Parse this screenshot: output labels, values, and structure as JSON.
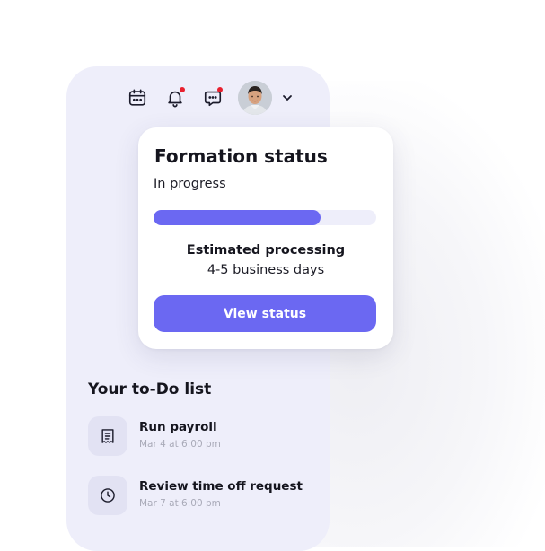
{
  "header": {
    "icons": [
      "calendar-icon",
      "bell-icon",
      "chat-icon"
    ],
    "notification_color": "#e8202e",
    "avatar": "user-avatar",
    "menu_chevron": "chevron-down-icon"
  },
  "formation_card": {
    "title": "Formation status",
    "status": "In progress",
    "progress_fraction": 0.75,
    "estimated_label": "Estimated processing",
    "estimated_value": "4-5 business days",
    "button_label": "View status",
    "accent_color": "#6b68f2"
  },
  "todo": {
    "title": "Your to-Do list",
    "items": [
      {
        "name": "Run payroll",
        "time": "Mar 4 at 6:00 pm",
        "icon": "receipt-icon"
      },
      {
        "name": "Review time off request",
        "time": "Mar 7 at 6:00 pm",
        "icon": "clock-icon"
      }
    ]
  }
}
